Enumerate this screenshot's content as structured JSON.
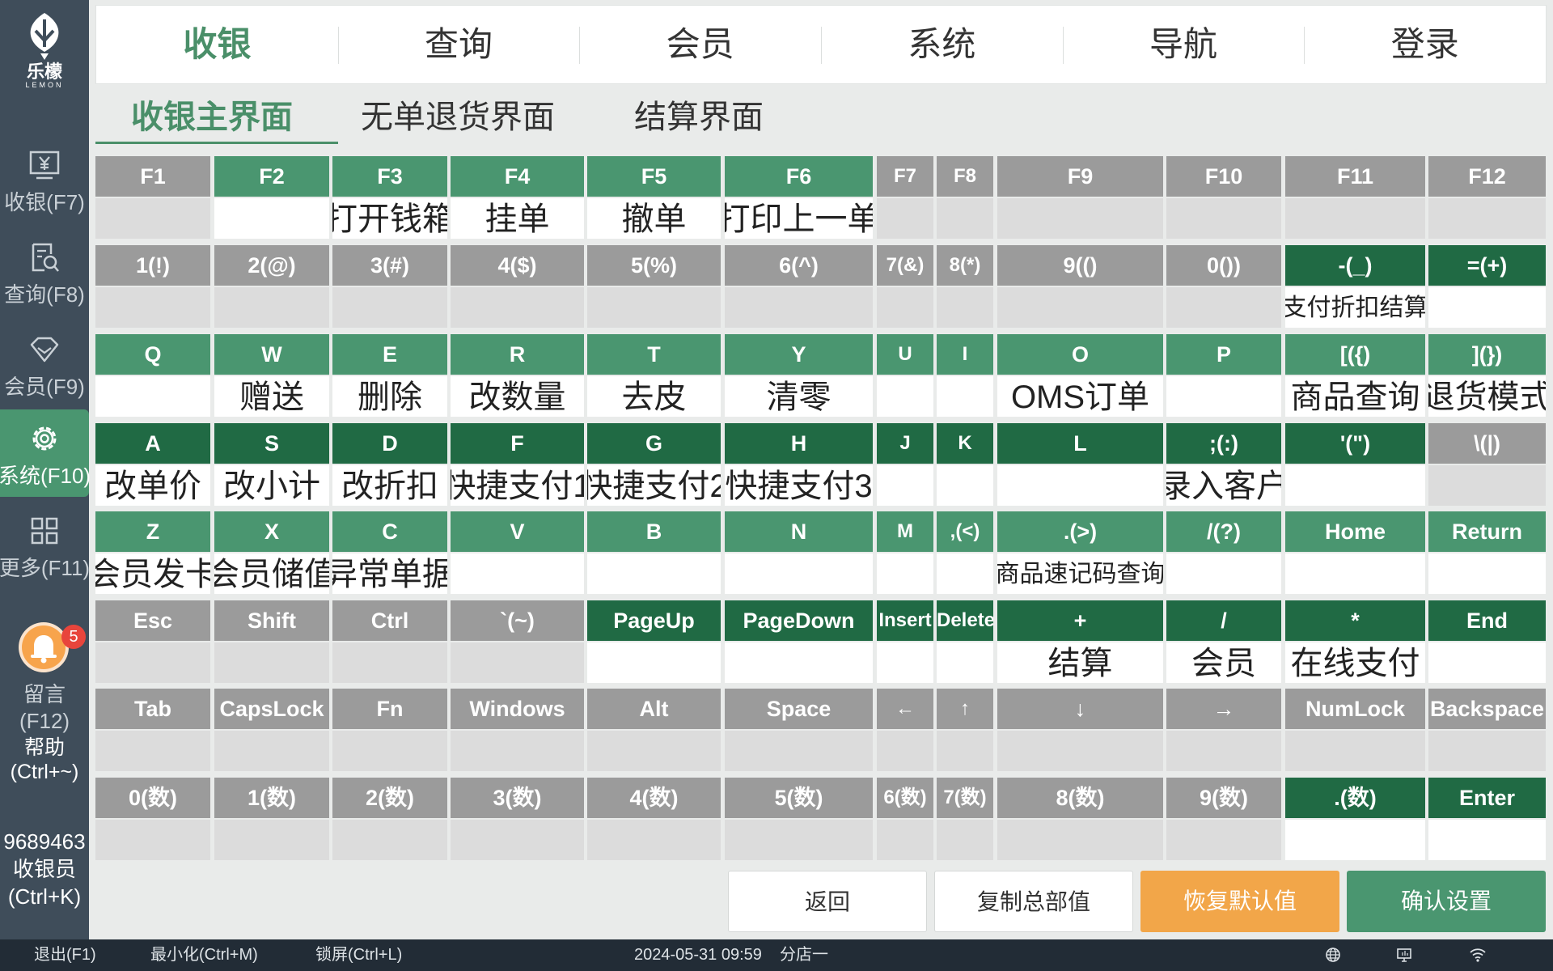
{
  "sidebar": {
    "logo": {
      "text": "乐檬",
      "sub": "LEMON"
    },
    "items": [
      {
        "label": "收银(F7)",
        "icon": "cash-register-icon",
        "active": false
      },
      {
        "label": "查询(F8)",
        "icon": "search-document-icon",
        "active": false
      },
      {
        "label": "会员(F9)",
        "icon": "diamond-icon",
        "active": false
      },
      {
        "label": "系统(F10)",
        "icon": "gear-icon",
        "active": true
      },
      {
        "label": "更多(F11)",
        "icon": "grid-icon",
        "active": false
      }
    ],
    "message": {
      "label": "留言(F12)",
      "badge": "5",
      "icon": "bell-icon"
    },
    "help": {
      "line1": "帮助",
      "line2": "(Ctrl+~)"
    },
    "user": {
      "id": "9689463",
      "role": "收银员",
      "shortcut": "(Ctrl+K)"
    }
  },
  "top_tabs": [
    {
      "label": "收银",
      "active": true
    },
    {
      "label": "查询",
      "active": false
    },
    {
      "label": "会员",
      "active": false
    },
    {
      "label": "系统",
      "active": false
    },
    {
      "label": "导航",
      "active": false
    },
    {
      "label": "登录",
      "active": false
    }
  ],
  "sub_tabs": [
    {
      "label": "收银主界面",
      "active": true
    },
    {
      "label": "无单退货界面",
      "active": false
    },
    {
      "label": "结算界面",
      "active": false
    }
  ],
  "colors": {
    "key_unassigned": "#9b9b9b",
    "key_assigned": "#4a9670",
    "key_assigned_dark": "#206a44",
    "accent": "#4a8f69",
    "sidebar_bg": "#3f4d5a"
  },
  "keys": [
    [
      {
        "name": "F1",
        "func": "",
        "color": "gray"
      },
      {
        "name": "F2",
        "func": "",
        "color": "green"
      },
      {
        "name": "F3",
        "func": "打开钱箱",
        "color": "green"
      },
      {
        "name": "F4",
        "func": "挂单",
        "color": "green"
      },
      {
        "name": "F5",
        "func": "撤单",
        "color": "green"
      },
      {
        "name": "F6",
        "func": "打印上一单",
        "color": "green"
      },
      {
        "name": "F7",
        "func": "",
        "color": "gray"
      },
      {
        "name": "F8",
        "func": "",
        "color": "gray"
      },
      {
        "name": "F9",
        "func": "",
        "color": "gray"
      },
      {
        "name": "F10",
        "func": "",
        "color": "gray"
      },
      {
        "name": "F11",
        "func": "",
        "color": "gray"
      },
      {
        "name": "F12",
        "func": "",
        "color": "gray"
      }
    ],
    [
      {
        "name": "1(!)",
        "func": "",
        "color": "gray"
      },
      {
        "name": "2(@)",
        "func": "",
        "color": "gray"
      },
      {
        "name": "3(#)",
        "func": "",
        "color": "gray"
      },
      {
        "name": "4($)",
        "func": "",
        "color": "gray"
      },
      {
        "name": "5(%)",
        "func": "",
        "color": "gray"
      },
      {
        "name": "6(^)",
        "func": "",
        "color": "gray"
      },
      {
        "name": "7(&)",
        "func": "",
        "color": "gray"
      },
      {
        "name": "8(*)",
        "func": "",
        "color": "gray"
      },
      {
        "name": "9(()",
        "func": "",
        "color": "gray"
      },
      {
        "name": "0())",
        "func": "",
        "color": "gray"
      },
      {
        "name": "-(_)",
        "func": "支付折扣结算",
        "color": "dark"
      },
      {
        "name": "=(+)",
        "func": "",
        "color": "dark"
      }
    ],
    [
      {
        "name": "Q",
        "func": "",
        "color": "green"
      },
      {
        "name": "W",
        "func": "赠送",
        "color": "green"
      },
      {
        "name": "E",
        "func": "删除",
        "color": "green"
      },
      {
        "name": "R",
        "func": "改数量",
        "color": "green"
      },
      {
        "name": "T",
        "func": "去皮",
        "color": "green"
      },
      {
        "name": "Y",
        "func": "清零",
        "color": "green"
      },
      {
        "name": "U",
        "func": "",
        "color": "green"
      },
      {
        "name": "I",
        "func": "",
        "color": "green"
      },
      {
        "name": "O",
        "func": "OMS订单",
        "color": "green"
      },
      {
        "name": "P",
        "func": "",
        "color": "green"
      },
      {
        "name": "[({)",
        "func": "商品查询",
        "color": "green"
      },
      {
        "name": "](})",
        "func": "退货模式",
        "color": "green"
      }
    ],
    [
      {
        "name": "A",
        "func": "改单价",
        "color": "dark"
      },
      {
        "name": "S",
        "func": "改小计",
        "color": "dark"
      },
      {
        "name": "D",
        "func": "改折扣",
        "color": "dark"
      },
      {
        "name": "F",
        "func": "快捷支付1",
        "color": "dark"
      },
      {
        "name": "G",
        "func": "快捷支付2",
        "color": "dark"
      },
      {
        "name": "H",
        "func": "快捷支付3",
        "color": "dark"
      },
      {
        "name": "J",
        "func": "",
        "color": "dark"
      },
      {
        "name": "K",
        "func": "",
        "color": "dark"
      },
      {
        "name": "L",
        "func": "",
        "color": "dark"
      },
      {
        "name": ";(:)",
        "func": "录入客户",
        "color": "dark"
      },
      {
        "name": "'(\")",
        "func": "",
        "color": "dark"
      },
      {
        "name": "\\(|)",
        "func": "",
        "color": "gray"
      }
    ],
    [
      {
        "name": "Z",
        "func": "会员发卡",
        "color": "green"
      },
      {
        "name": "X",
        "func": "会员储值",
        "color": "green"
      },
      {
        "name": "C",
        "func": "异常单据",
        "color": "green"
      },
      {
        "name": "V",
        "func": "",
        "color": "green"
      },
      {
        "name": "B",
        "func": "",
        "color": "green"
      },
      {
        "name": "N",
        "func": "",
        "color": "green"
      },
      {
        "name": "M",
        "func": "",
        "color": "green"
      },
      {
        "name": ",(<)",
        "func": "",
        "color": "green"
      },
      {
        "name": ".(>)",
        "func": "商品速记码查询",
        "color": "green"
      },
      {
        "name": "/(?)",
        "func": "",
        "color": "green"
      },
      {
        "name": "Home",
        "func": "",
        "color": "green"
      },
      {
        "name": "Return",
        "func": "",
        "color": "green"
      }
    ],
    [
      {
        "name": "Esc",
        "func": "",
        "color": "gray"
      },
      {
        "name": "Shift",
        "func": "",
        "color": "gray"
      },
      {
        "name": "Ctrl",
        "func": "",
        "color": "gray"
      },
      {
        "name": "`(~)",
        "func": "",
        "color": "gray"
      },
      {
        "name": "PageUp",
        "func": "",
        "color": "dark"
      },
      {
        "name": "PageDown",
        "func": "",
        "color": "dark"
      },
      {
        "name": "Insert",
        "func": "",
        "color": "dark"
      },
      {
        "name": "Delete",
        "func": "",
        "color": "dark"
      },
      {
        "name": "+",
        "func": "结算",
        "color": "dark"
      },
      {
        "name": "/",
        "func": "会员",
        "color": "dark"
      },
      {
        "name": "*",
        "func": "在线支付",
        "color": "dark"
      },
      {
        "name": "End",
        "func": "",
        "color": "dark"
      }
    ],
    [
      {
        "name": "Tab",
        "func": "",
        "color": "gray"
      },
      {
        "name": "CapsLock",
        "func": "",
        "color": "gray"
      },
      {
        "name": "Fn",
        "func": "",
        "color": "gray"
      },
      {
        "name": "Windows",
        "func": "",
        "color": "gray"
      },
      {
        "name": "Alt",
        "func": "",
        "color": "gray"
      },
      {
        "name": "Space",
        "func": "",
        "color": "gray"
      },
      {
        "name": "←",
        "func": "",
        "color": "gray"
      },
      {
        "name": "↑",
        "func": "",
        "color": "gray"
      },
      {
        "name": "↓",
        "func": "",
        "color": "gray"
      },
      {
        "name": "→",
        "func": "",
        "color": "gray"
      },
      {
        "name": "NumLock",
        "func": "",
        "color": "gray"
      },
      {
        "name": "Backspace",
        "func": "",
        "color": "gray"
      }
    ],
    [
      {
        "name": "0(数)",
        "func": "",
        "color": "gray"
      },
      {
        "name": "1(数)",
        "func": "",
        "color": "gray"
      },
      {
        "name": "2(数)",
        "func": "",
        "color": "gray"
      },
      {
        "name": "3(数)",
        "func": "",
        "color": "gray"
      },
      {
        "name": "4(数)",
        "func": "",
        "color": "gray"
      },
      {
        "name": "5(数)",
        "func": "",
        "color": "gray"
      },
      {
        "name": "6(数)",
        "func": "",
        "color": "gray"
      },
      {
        "name": "7(数)",
        "func": "",
        "color": "gray"
      },
      {
        "name": "8(数)",
        "func": "",
        "color": "gray"
      },
      {
        "name": "9(数)",
        "func": "",
        "color": "gray"
      },
      {
        "name": ".(数)",
        "func": "",
        "color": "dark"
      },
      {
        "name": "Enter",
        "func": "",
        "color": "dark"
      }
    ]
  ],
  "buttons": {
    "back": "返回",
    "copy_hq": "复制总部值",
    "restore_default": "恢复默认值",
    "confirm": "确认设置"
  },
  "statusbar": {
    "exit": "退出(F1)",
    "minimize": "最小化(Ctrl+M)",
    "lock": "锁屏(Ctrl+L)",
    "datetime": "2024-05-31 09:59",
    "store": "分店一",
    "icons": [
      "globe-icon",
      "monitor-icon",
      "wifi-icon"
    ]
  }
}
